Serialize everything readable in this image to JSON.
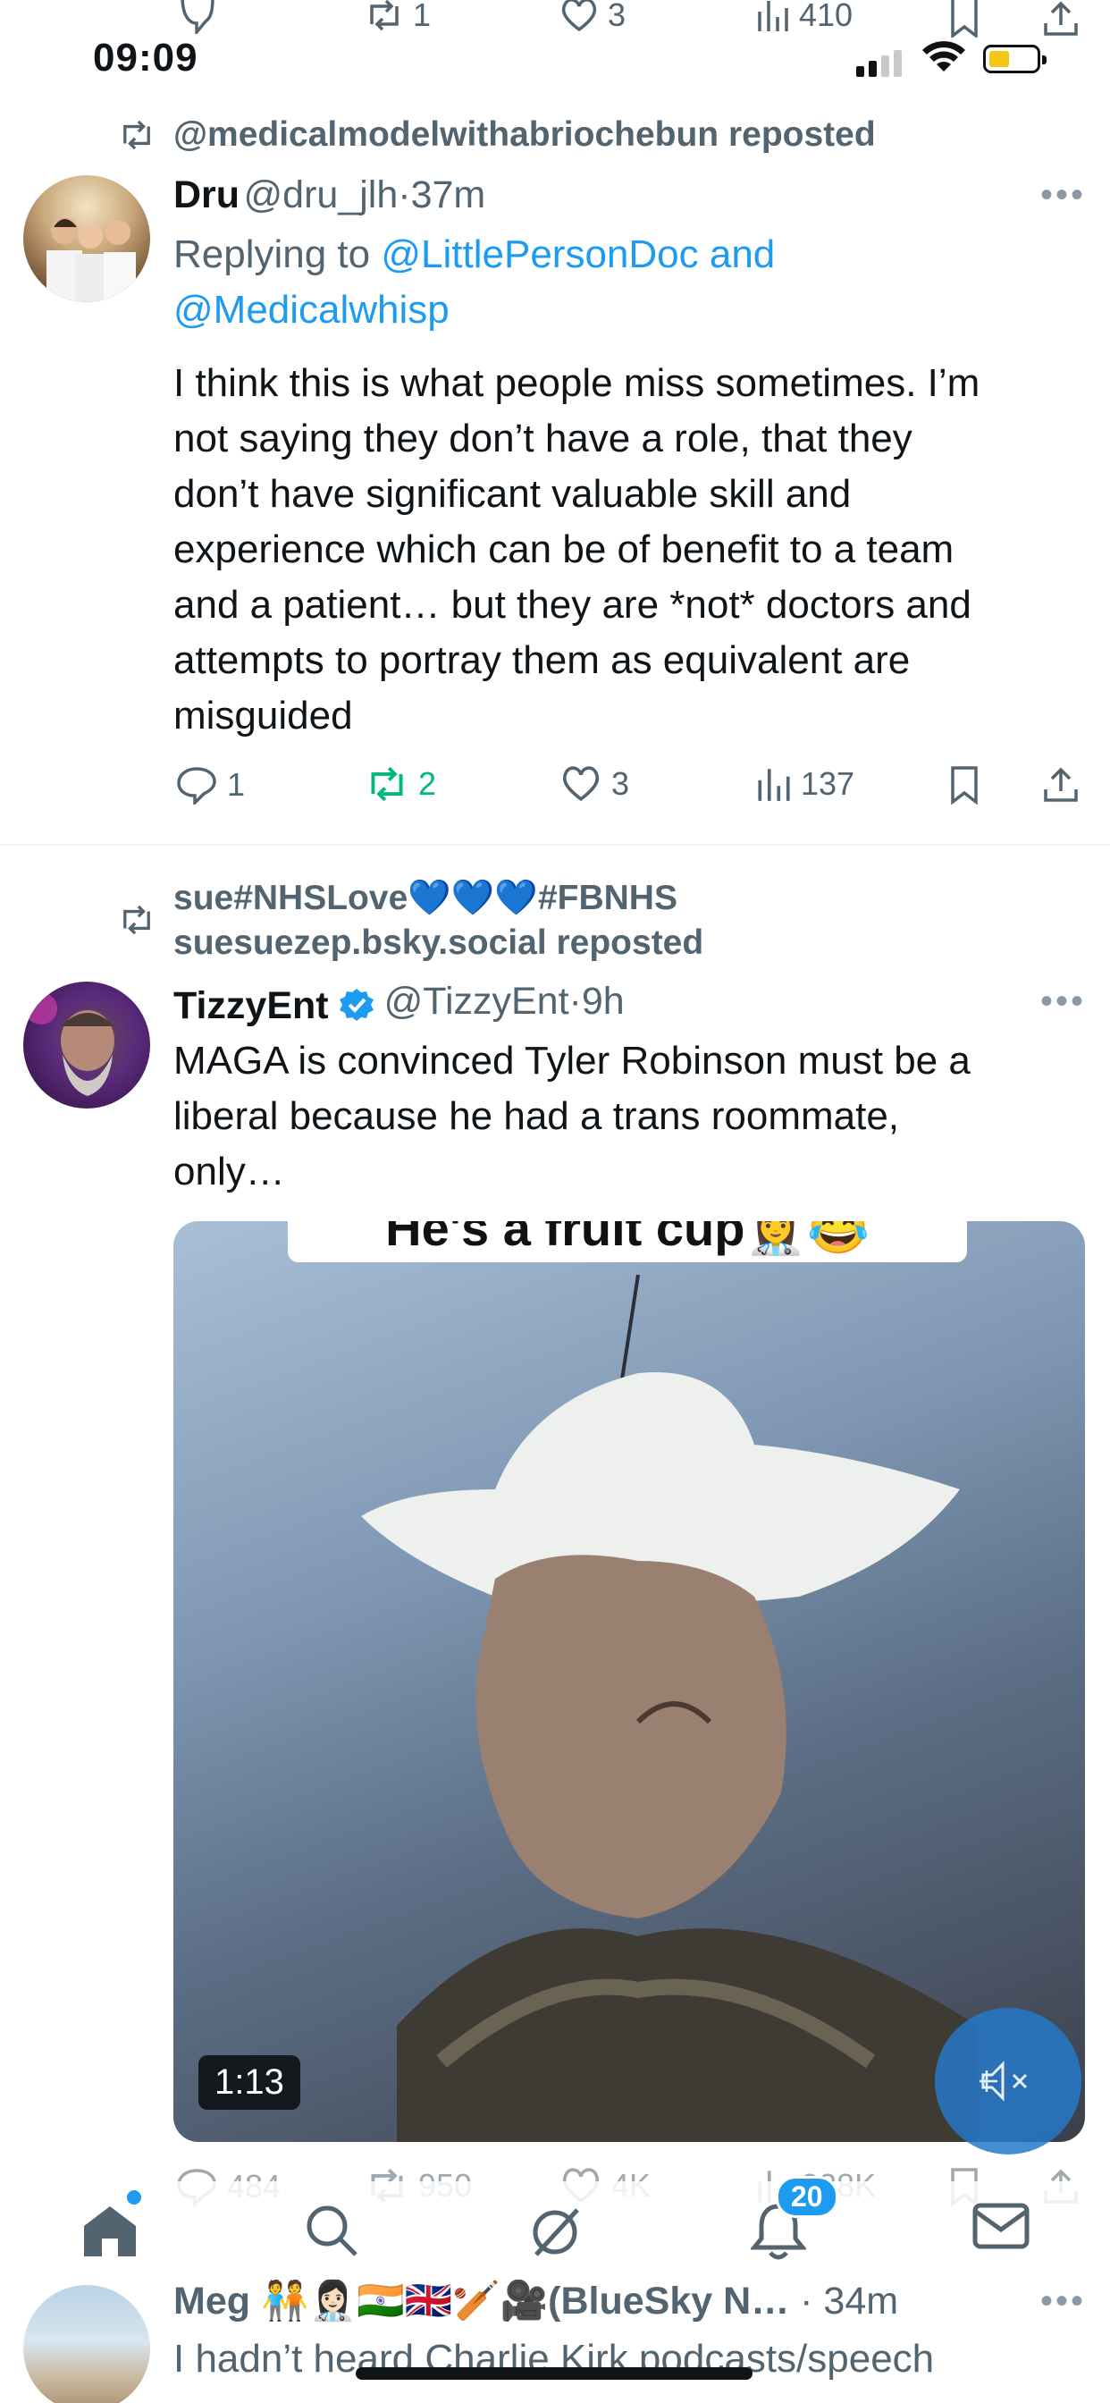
{
  "status_bar": {
    "time": "09:09"
  },
  "top_actions": {
    "replies": "",
    "reposts": "1",
    "likes": "3",
    "views": "410"
  },
  "post1": {
    "reposted_by": "@medicalmodelwithabriochebun reposted",
    "author_name": "Dru",
    "author_handle": "@dru_jlh",
    "time": "37m",
    "replying_prefix": "Replying to ",
    "replying_to_1": "@LittlePersonDoc",
    "replying_and": " and",
    "replying_to_2": "@Medicalwhisp",
    "text_lines": [
      "I think this is what people miss sometimes. I’m",
      "not saying they don’t have a role, that they",
      "don’t have significant valuable skill and",
      "experience which can be of benefit to a team",
      "and a patient… but they are *not* doctors and",
      "attempts to portray them as equivalent are",
      "misguided"
    ],
    "replies": "1",
    "reposts": "2",
    "likes": "3",
    "views": "137"
  },
  "post2": {
    "reposted_by_line1": "sue#NHSLove💙💙💙#FBNHS",
    "reposted_by_line2": "suesuezep.bsky.social reposted",
    "author_name": "TizzyEnt",
    "author_handle": "@TizzyEnt",
    "time": "9h",
    "text_lines": [
      "MAGA is convinced Tyler Robinson must be a",
      "liberal because he had a trans roommate,",
      "only…"
    ],
    "video_caption": "He's a fruit cup👩‍⚕️😂",
    "video_duration": "1:13",
    "replies": "484",
    "reposts": "950",
    "likes": "4K",
    "views": "228K"
  },
  "post3": {
    "author_name": "Meg 🧑‍🤝‍🧑👩🏻‍⚕️🇮🇳🇬🇧🏏🎥(BlueSky N…",
    "time": "34m",
    "text_line": "I hadn’t heard Charlie Kirk podcasts/speech"
  },
  "nav": {
    "notifications_badge": "20"
  },
  "colors": {
    "accent": "#1d9bf0",
    "repost_green": "#00ba7c",
    "muted": "#536471"
  }
}
